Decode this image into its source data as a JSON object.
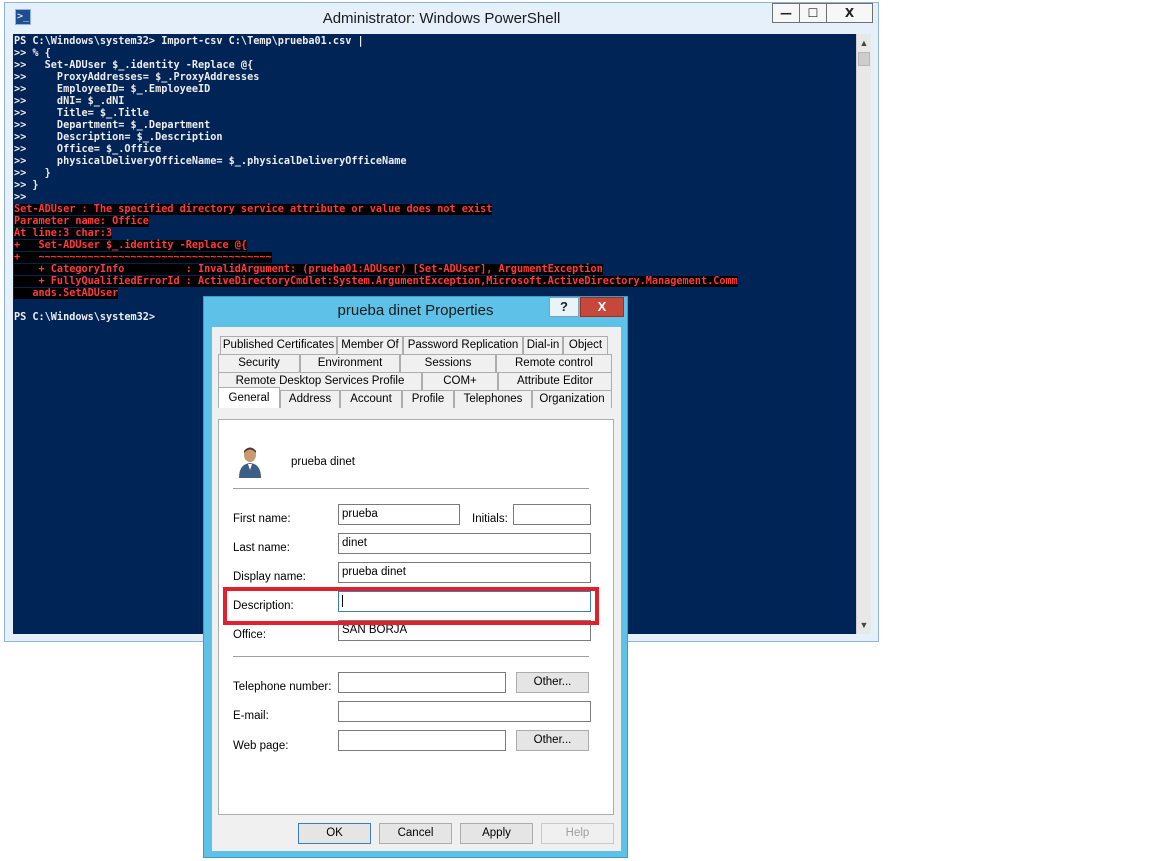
{
  "powershell": {
    "title": "Administrator: Windows PowerShell",
    "icon": "powershell-icon",
    "controls": {
      "minimize": "—",
      "maximize": "☐",
      "close": "X"
    },
    "lines": [
      {
        "text": "PS C:\\Windows\\system32> Import-csv C:\\Temp\\prueba01.csv |",
        "error": false
      },
      {
        "text": ">> % {",
        "error": false
      },
      {
        "text": ">>   Set-ADUser $_.identity -Replace @{",
        "error": false
      },
      {
        "text": ">>     ProxyAddresses= $_.ProxyAddresses",
        "error": false
      },
      {
        "text": ">>     EmployeeID= $_.EmployeeID",
        "error": false
      },
      {
        "text": ">>     dNI= $_.dNI",
        "error": false
      },
      {
        "text": ">>     Title= $_.Title",
        "error": false
      },
      {
        "text": ">>     Department= $_.Department",
        "error": false
      },
      {
        "text": ">>     Description= $_.Description",
        "error": false
      },
      {
        "text": ">>     Office= $_.Office",
        "error": false
      },
      {
        "text": ">>     physicalDeliveryOfficeName= $_.physicalDeliveryOfficeName",
        "error": false
      },
      {
        "text": ">>   }",
        "error": false
      },
      {
        "text": ">> }",
        "error": false
      },
      {
        "text": ">>",
        "error": false
      },
      {
        "text": "Set-ADUser : The specified directory service attribute or value does not exist",
        "error": true
      },
      {
        "text": "Parameter name: Office",
        "error": true
      },
      {
        "text": "At line:3 char:3",
        "error": true
      },
      {
        "text": "+   Set-ADUser $_.identity -Replace @{",
        "error": true
      },
      {
        "text": "+   ~~~~~~~~~~~~~~~~~~~~~~~~~~~~~~~~~~~~~~",
        "error": true
      },
      {
        "text": "    + CategoryInfo          : InvalidArgument: (prueba01:ADUser) [Set-ADUser], ArgumentException",
        "error": true
      },
      {
        "text": "    + FullyQualifiedErrorId : ActiveDirectoryCmdlet:System.ArgumentException,Microsoft.ActiveDirectory.Management.Comm",
        "error": true
      },
      {
        "text": "   ands.SetADUser",
        "error": true
      },
      {
        "text": "",
        "error": false
      },
      {
        "text": "PS C:\\Windows\\system32>",
        "error": false
      }
    ]
  },
  "dialog": {
    "title": "prueba dinet Properties",
    "help_label": "?",
    "close_label": "X",
    "tabs_row1": [
      "Published Certificates",
      "Member Of",
      "Password Replication",
      "Dial-in",
      "Object"
    ],
    "tabs_row2": [
      "Security",
      "Environment",
      "Sessions",
      "Remote control"
    ],
    "tabs_row3": [
      "Remote Desktop Services Profile",
      "COM+",
      "Attribute Editor"
    ],
    "tabs_row4": [
      "General",
      "Address",
      "Account",
      "Profile",
      "Telephones",
      "Organization"
    ],
    "active_tab": "General",
    "user_display": "prueba dinet",
    "fields": {
      "first_name": {
        "label": "First name:",
        "value": "prueba"
      },
      "initials": {
        "label": "Initials:",
        "value": ""
      },
      "last_name": {
        "label": "Last name:",
        "value": "dinet"
      },
      "display_name": {
        "label": "Display name:",
        "value": "prueba dinet"
      },
      "description": {
        "label": "Description:",
        "value": ""
      },
      "office": {
        "label": "Office:",
        "value": "SAN BORJA"
      },
      "telephone": {
        "label": "Telephone number:",
        "value": ""
      },
      "email": {
        "label": "E-mail:",
        "value": ""
      },
      "web_page": {
        "label": "Web page:",
        "value": ""
      }
    },
    "other_label": "Other...",
    "buttons": {
      "ok": "OK",
      "cancel": "Cancel",
      "apply": "Apply",
      "help": "Help"
    },
    "highlight_color": "#e0202c"
  }
}
